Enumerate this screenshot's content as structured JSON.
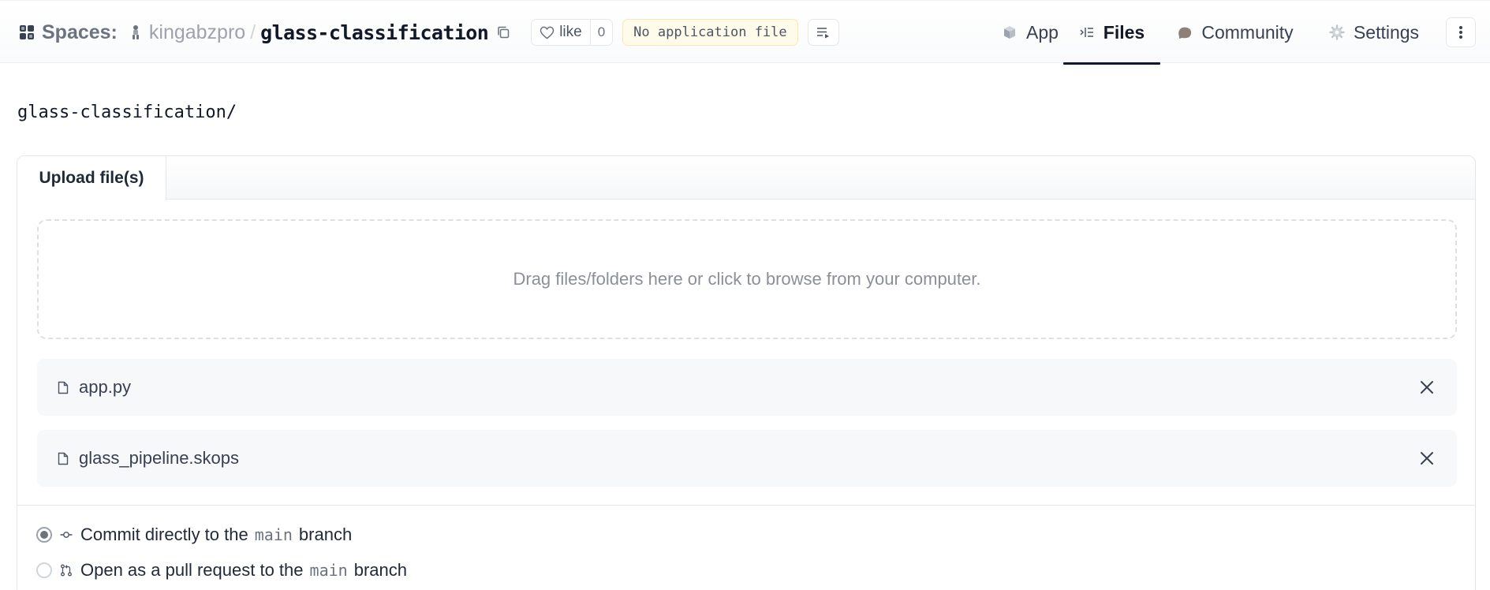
{
  "header": {
    "spaces_label": "Spaces:",
    "owner": "kingabzpro",
    "separator": "/",
    "repo": "glass-classification",
    "like_label": "like",
    "like_count": "0",
    "status_badge": "No application file"
  },
  "nav": {
    "tabs": [
      {
        "label": "App",
        "icon": "cube-icon"
      },
      {
        "label": "Files",
        "icon": "files-icon",
        "active": true
      },
      {
        "label": "Community",
        "icon": "community-icon"
      },
      {
        "label": "Settings",
        "icon": "gear-icon"
      }
    ]
  },
  "main": {
    "path": "glass-classification/",
    "upload_tab": "Upload file(s)",
    "dropzone_text": "Drag files/folders here or click to browse from your computer.",
    "files": [
      {
        "name": "app.py"
      },
      {
        "name": "glass_pipeline.skops"
      }
    ],
    "commit_options": [
      {
        "prefix": "Commit directly to the",
        "branch": "main",
        "suffix": "branch",
        "selected": true
      },
      {
        "prefix": "Open as a pull request to the",
        "branch": "main",
        "suffix": "branch",
        "selected": false
      }
    ]
  },
  "colors": {
    "active_tab_underline": "#111827",
    "status_badge_bg": "#fffbeb",
    "file_row_bg": "#f7f8fa"
  }
}
